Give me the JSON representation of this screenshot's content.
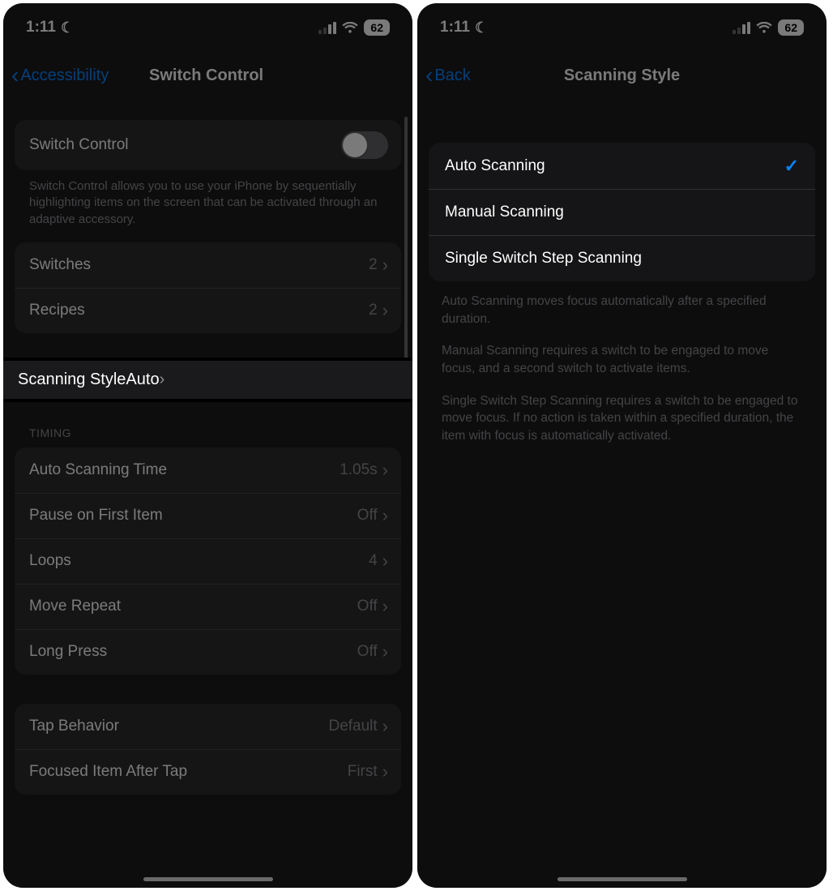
{
  "status": {
    "time": "1:11",
    "battery": "62"
  },
  "left": {
    "back_label": "Accessibility",
    "title": "Switch Control",
    "toggle_label": "Switch Control",
    "toggle_desc": "Switch Control allows you to use your iPhone by sequentially highlighting items on the screen that can be activated through an adaptive accessory.",
    "switches": {
      "label": "Switches",
      "value": "2"
    },
    "recipes": {
      "label": "Recipes",
      "value": "2"
    },
    "scanning_style": {
      "label": "Scanning Style",
      "value": "Auto"
    },
    "timing_header": "TIMING",
    "timing": {
      "auto_time": {
        "label": "Auto Scanning Time",
        "value": "1.05s"
      },
      "pause_first": {
        "label": "Pause on First Item",
        "value": "Off"
      },
      "loops": {
        "label": "Loops",
        "value": "4"
      },
      "move_repeat": {
        "label": "Move Repeat",
        "value": "Off"
      },
      "long_press": {
        "label": "Long Press",
        "value": "Off"
      }
    },
    "tap_behavior": {
      "label": "Tap Behavior",
      "value": "Default"
    },
    "focused_after_tap": {
      "label": "Focused Item After Tap",
      "value": "First"
    }
  },
  "right": {
    "back_label": "Back",
    "title": "Scanning Style",
    "options": {
      "auto": "Auto Scanning",
      "manual": "Manual Scanning",
      "single": "Single Switch Step Scanning"
    },
    "desc1": "Auto Scanning moves focus automatically after a specified duration.",
    "desc2": "Manual Scanning requires a switch to be engaged to move focus, and a second switch to activate items.",
    "desc3": "Single Switch Step Scanning requires a switch to be engaged to move focus. If no action is taken within a specified duration, the item with focus is automatically activated."
  }
}
